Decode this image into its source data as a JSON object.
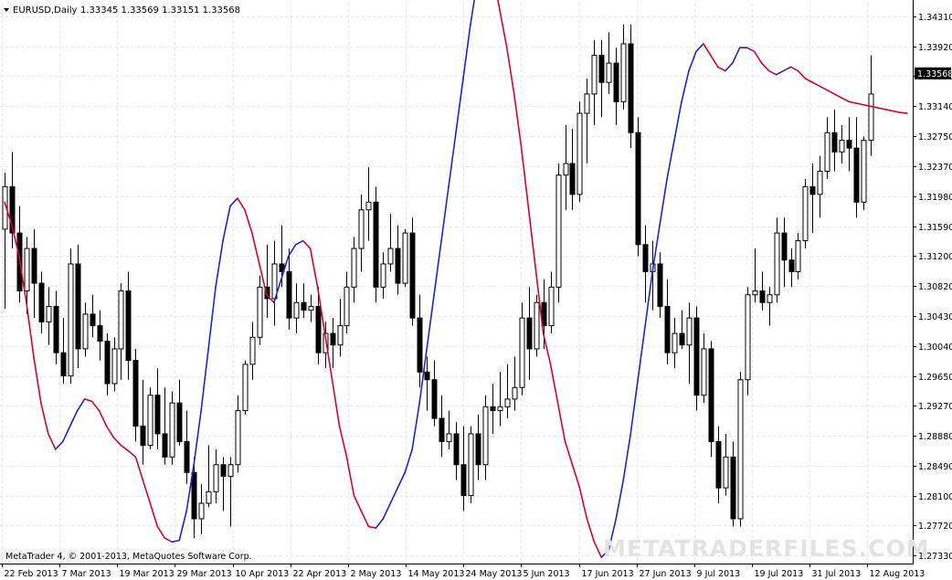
{
  "header": {
    "symbol": "EURUSD,Daily",
    "ohlc": "1.33345 1.33569 1.33151 1.33568"
  },
  "footer": {
    "copyright": "MetaTrader 4, © 2001-2013, MetaQuotes Software Corp.",
    "watermark": "METATRADERFILES.COM"
  },
  "colors": {
    "background": "#ffffff",
    "grid": "#e6e6e6",
    "candle": "#000000",
    "ma_up": "#2020e0",
    "ma_down": "#e00030",
    "price_label_bg": "#000000"
  },
  "chart_data": {
    "type": "candlestick",
    "symbol": "EURUSD",
    "timeframe": "Daily",
    "grid": true,
    "ylim": [
      1.2722,
      1.3447
    ],
    "y_ticks": [
      "1.34310",
      "1.33920",
      "1.33530",
      "1.33140",
      "1.32750",
      "1.32370",
      "1.31980",
      "1.31590",
      "1.31200",
      "1.30820",
      "1.30430",
      "1.30040",
      "1.29650",
      "1.29270",
      "1.28880",
      "1.28490",
      "1.28100",
      "1.27720",
      "1.27330"
    ],
    "x_labels": [
      "22 Feb 2013",
      "7 Mar 2013",
      "19 Mar 2013",
      "29 Mar 2013",
      "10 Apr 2013",
      "22 Apr 2013",
      "2 May 2013",
      "14 May 2013",
      "24 May 2013",
      "5 Jun 2013",
      "17 Jun 2013",
      "27 Jun 2013",
      "9 Jul 2013",
      "19 Jul 2013",
      "31 Jul 2013",
      "12 Aug 2013"
    ],
    "current_price": "1.33568",
    "bar_count": 125,
    "candles_ohlc": [
      [
        1.3155,
        1.3228,
        1.3052,
        1.321
      ],
      [
        1.321,
        1.3255,
        1.313,
        1.315
      ],
      [
        1.315,
        1.3185,
        1.306,
        1.3075
      ],
      [
        1.3075,
        1.3145,
        1.3045,
        1.313
      ],
      [
        1.313,
        1.3155,
        1.304,
        1.3085
      ],
      [
        1.3085,
        1.31,
        1.302,
        1.3035
      ],
      [
        1.3035,
        1.308,
        1.3005,
        1.3055
      ],
      [
        1.3055,
        1.3075,
        1.298,
        1.2995
      ],
      [
        1.2995,
        1.304,
        1.2955,
        1.2965
      ],
      [
        1.2965,
        1.313,
        1.2955,
        1.311
      ],
      [
        1.311,
        1.3135,
        1.2975,
        1.3
      ],
      [
        1.3,
        1.306,
        1.299,
        1.3045
      ],
      [
        1.3045,
        1.307,
        1.3015,
        1.303
      ],
      [
        1.303,
        1.305,
        1.2985,
        1.301
      ],
      [
        1.301,
        1.302,
        1.294,
        1.2955
      ],
      [
        1.2955,
        1.3015,
        1.2945,
        1.3
      ],
      [
        1.3,
        1.3085,
        1.296,
        1.3075
      ],
      [
        1.3075,
        1.31,
        1.296,
        1.2985
      ],
      [
        1.2985,
        1.3,
        1.288,
        1.29
      ],
      [
        1.29,
        1.296,
        1.285,
        1.2875
      ],
      [
        1.2875,
        1.295,
        1.287,
        1.294
      ],
      [
        1.294,
        1.2975,
        1.287,
        1.289
      ],
      [
        1.289,
        1.295,
        1.285,
        1.286
      ],
      [
        1.286,
        1.2945,
        1.285,
        1.293
      ],
      [
        1.293,
        1.296,
        1.2875,
        1.288
      ],
      [
        1.288,
        1.292,
        1.2825,
        1.284
      ],
      [
        1.284,
        1.286,
        1.2755,
        1.278
      ],
      [
        1.278,
        1.2825,
        1.276,
        1.28
      ],
      [
        1.28,
        1.2875,
        1.2795,
        1.2815
      ],
      [
        1.2815,
        1.287,
        1.28,
        1.285
      ],
      [
        1.285,
        1.286,
        1.279,
        1.2835
      ],
      [
        1.2835,
        1.286,
        1.277,
        1.285
      ],
      [
        1.285,
        1.294,
        1.284,
        1.292
      ],
      [
        1.292,
        1.2985,
        1.2915,
        1.298
      ],
      [
        1.298,
        1.3035,
        1.296,
        1.3015
      ],
      [
        1.3015,
        1.3095,
        1.3005,
        1.308
      ],
      [
        1.308,
        1.3135,
        1.304,
        1.3065
      ],
      [
        1.3065,
        1.314,
        1.303,
        1.311
      ],
      [
        1.311,
        1.316,
        1.308,
        1.31
      ],
      [
        1.31,
        1.313,
        1.3025,
        1.304
      ],
      [
        1.304,
        1.3085,
        1.302,
        1.306
      ],
      [
        1.306,
        1.3085,
        1.304,
        1.305
      ],
      [
        1.305,
        1.307,
        1.3035,
        1.3055
      ],
      [
        1.3055,
        1.308,
        1.298,
        1.2995
      ],
      [
        1.2995,
        1.3035,
        1.2975,
        1.302
      ],
      [
        1.302,
        1.304,
        1.2975,
        1.3005
      ],
      [
        1.3005,
        1.3065,
        1.299,
        1.303
      ],
      [
        1.303,
        1.31,
        1.302,
        1.308
      ],
      [
        1.308,
        1.3145,
        1.306,
        1.313
      ],
      [
        1.313,
        1.32,
        1.31,
        1.318
      ],
      [
        1.318,
        1.3235,
        1.314,
        1.319
      ],
      [
        1.319,
        1.321,
        1.306,
        1.308
      ],
      [
        1.308,
        1.3125,
        1.3065,
        1.311
      ],
      [
        1.311,
        1.3175,
        1.31,
        1.313
      ],
      [
        1.313,
        1.316,
        1.307,
        1.3085
      ],
      [
        1.3085,
        1.3155,
        1.308,
        1.315
      ],
      [
        1.315,
        1.317,
        1.303,
        1.304
      ],
      [
        1.304,
        1.307,
        1.295,
        1.297
      ],
      [
        1.297,
        1.299,
        1.292,
        1.296
      ],
      [
        1.296,
        1.2985,
        1.29,
        1.291
      ],
      [
        1.291,
        1.294,
        1.286,
        1.288
      ],
      [
        1.288,
        1.292,
        1.287,
        1.289
      ],
      [
        1.289,
        1.2905,
        1.283,
        1.285
      ],
      [
        1.285,
        1.29,
        1.279,
        1.281
      ],
      [
        1.281,
        1.29,
        1.28,
        1.289
      ],
      [
        1.289,
        1.2915,
        1.283,
        1.285
      ],
      [
        1.285,
        1.294,
        1.283,
        1.2925
      ],
      [
        1.2925,
        1.2955,
        1.289,
        1.292
      ],
      [
        1.292,
        1.297,
        1.29,
        1.2925
      ],
      [
        1.2925,
        1.298,
        1.291,
        1.2935
      ],
      [
        1.2935,
        1.299,
        1.292,
        1.295
      ],
      [
        1.295,
        1.306,
        1.294,
        1.304
      ],
      [
        1.304,
        1.308,
        1.296,
        1.3
      ],
      [
        1.3,
        1.307,
        1.299,
        1.306
      ],
      [
        1.306,
        1.309,
        1.3,
        1.303
      ],
      [
        1.303,
        1.31,
        1.302,
        1.308
      ],
      [
        1.308,
        1.324,
        1.306,
        1.3225
      ],
      [
        1.3225,
        1.329,
        1.318,
        1.324
      ],
      [
        1.324,
        1.3285,
        1.318,
        1.32
      ],
      [
        1.32,
        1.332,
        1.319,
        1.3305
      ],
      [
        1.3305,
        1.335,
        1.324,
        1.333
      ],
      [
        1.333,
        1.34,
        1.329,
        1.338
      ],
      [
        1.338,
        1.34,
        1.33,
        1.3345
      ],
      [
        1.3345,
        1.341,
        1.333,
        1.337
      ],
      [
        1.337,
        1.339,
        1.329,
        1.332
      ],
      [
        1.332,
        1.342,
        1.331,
        1.3395
      ],
      [
        1.3395,
        1.342,
        1.326,
        1.328
      ],
      [
        1.328,
        1.33,
        1.312,
        1.3135
      ],
      [
        1.3135,
        1.316,
        1.306,
        1.31
      ],
      [
        1.31,
        1.314,
        1.305,
        1.311
      ],
      [
        1.311,
        1.3125,
        1.304,
        1.3055
      ],
      [
        1.3055,
        1.309,
        1.298,
        1.2995
      ],
      [
        1.2995,
        1.304,
        1.2975,
        1.302
      ],
      [
        1.302,
        1.305,
        1.3,
        1.3005
      ],
      [
        1.3005,
        1.306,
        1.2955,
        1.304
      ],
      [
        1.304,
        1.3055,
        1.292,
        1.294
      ],
      [
        1.294,
        1.302,
        1.293,
        1.3
      ],
      [
        1.3,
        1.301,
        1.286,
        1.288
      ],
      [
        1.288,
        1.29,
        1.28,
        1.282
      ],
      [
        1.282,
        1.289,
        1.281,
        1.286
      ],
      [
        1.286,
        1.288,
        1.277,
        1.278
      ],
      [
        1.278,
        1.297,
        1.277,
        1.296
      ],
      [
        1.296,
        1.308,
        1.294,
        1.307
      ],
      [
        1.307,
        1.313,
        1.306,
        1.3075
      ],
      [
        1.3075,
        1.31,
        1.305,
        1.306
      ],
      [
        1.306,
        1.308,
        1.303,
        1.307
      ],
      [
        1.307,
        1.317,
        1.306,
        1.315
      ],
      [
        1.315,
        1.317,
        1.308,
        1.3115
      ],
      [
        1.3115,
        1.313,
        1.308,
        1.31
      ],
      [
        1.31,
        1.315,
        1.309,
        1.314
      ],
      [
        1.314,
        1.322,
        1.313,
        1.321
      ],
      [
        1.321,
        1.324,
        1.315,
        1.32
      ],
      [
        1.32,
        1.325,
        1.317,
        1.323
      ],
      [
        1.323,
        1.33,
        1.322,
        1.328
      ],
      [
        1.328,
        1.331,
        1.323,
        1.3255
      ],
      [
        1.3255,
        1.329,
        1.324,
        1.327
      ],
      [
        1.327,
        1.33,
        1.323,
        1.326
      ],
      [
        1.326,
        1.33,
        1.317,
        1.319
      ],
      [
        1.319,
        1.3275,
        1.318,
        1.327
      ],
      [
        1.327,
        1.338,
        1.325,
        1.333
      ]
    ],
    "moving_average": [
      1.319,
      1.316,
      1.312,
      1.306,
      1.299,
      1.293,
      1.289,
      1.287,
      1.288,
      1.29,
      1.292,
      1.2935,
      1.2932,
      1.292,
      1.29,
      1.2885,
      1.2875,
      1.2868,
      1.286,
      1.283,
      1.28,
      1.277,
      1.2755,
      1.275,
      1.2752,
      1.279,
      1.285,
      1.292,
      1.3,
      1.308,
      1.314,
      1.3185,
      1.3195,
      1.318,
      1.315,
      1.311,
      1.307,
      1.306,
      1.309,
      1.312,
      1.3135,
      1.314,
      1.313,
      1.308,
      1.302,
      1.296,
      1.29,
      1.286,
      1.281,
      1.279,
      1.277,
      1.2768,
      1.278,
      1.28,
      1.282,
      1.284,
      1.287,
      1.293,
      1.3,
      1.307,
      1.314,
      1.321,
      1.328,
      1.335,
      1.342,
      1.348,
      1.349,
      1.349,
      1.344,
      1.339,
      1.333,
      1.326,
      1.318,
      1.31,
      1.302,
      1.298,
      1.293,
      1.288,
      1.285,
      1.282,
      1.278,
      1.275,
      1.273,
      1.274,
      1.278,
      1.283,
      1.289,
      1.296,
      1.303,
      1.31,
      1.316,
      1.322,
      1.327,
      1.332,
      1.336,
      1.3385,
      1.3395,
      1.338,
      1.3365,
      1.336,
      1.337,
      1.339,
      1.339,
      1.3385,
      1.337,
      1.336,
      1.3355,
      1.336,
      1.3365,
      1.336,
      1.335,
      1.3345,
      1.334,
      1.3335,
      1.333,
      1.3325,
      1.332,
      1.3318,
      1.3316,
      1.3314,
      1.3312,
      1.331,
      1.3308,
      1.3306,
      1.3305
    ]
  }
}
